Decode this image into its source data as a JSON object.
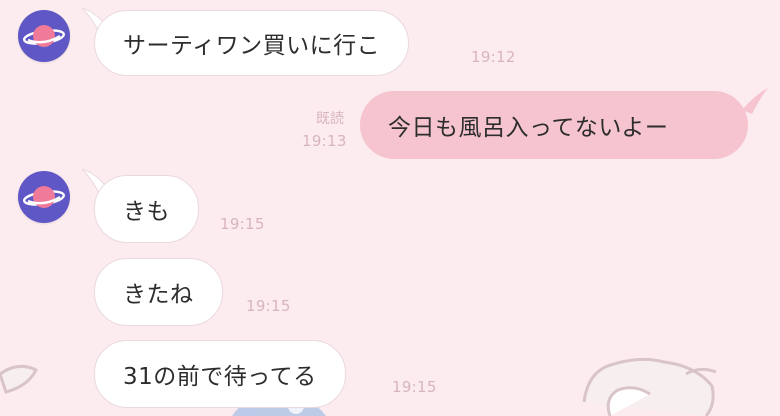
{
  "messages": [
    {
      "text": "サーティワン買いに行こ",
      "time": "19:12",
      "sender": "other",
      "avatar_icon": "planet-icon"
    },
    {
      "text": "今日も風呂入ってないよー",
      "time": "19:13",
      "sender": "me",
      "read_label": "既読"
    },
    {
      "text": "きも",
      "time": "19:15",
      "sender": "other",
      "avatar_icon": "planet-icon"
    },
    {
      "text": "きたね",
      "time": "19:15",
      "sender": "other"
    },
    {
      "text": "31の前で待ってる",
      "time": "19:15",
      "sender": "other"
    }
  ],
  "colors": {
    "background": "#fcecef",
    "incoming_bubble": "#ffffff",
    "outgoing_bubble": "#f5c4cf",
    "avatar": "#5f57c5",
    "planet": "#f07a9a",
    "timestamp": "#d8b5bd"
  }
}
